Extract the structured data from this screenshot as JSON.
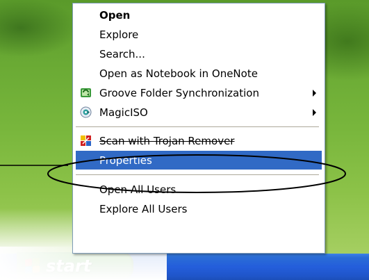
{
  "desktop": {
    "background_colors": [
      "#5a9a2a",
      "#a6cf62"
    ]
  },
  "taskbar": {
    "color": "#245edb",
    "start_label": "start",
    "start_icon": "windows-logo-icon"
  },
  "context_menu": {
    "highlight_color": "#316ac5",
    "items": [
      {
        "label": "Open"
      },
      {
        "label": "Explore"
      },
      {
        "label": "Search..."
      },
      {
        "label": "Open as Notebook in OneNote"
      },
      {
        "label": "Groove Folder Synchronization",
        "icon": "groove-icon"
      },
      {
        "label": "MagicISO",
        "icon": "magiciso-disc-icon"
      },
      {
        "label": "Scan with Trojan Remover",
        "icon": "trojan-remover-icon"
      },
      {
        "label": "Properties"
      },
      {
        "label": "Open All Users"
      },
      {
        "label": "Explore All Users"
      }
    ]
  },
  "annotation": {
    "type": "ellipse-callout",
    "target": "Properties"
  }
}
